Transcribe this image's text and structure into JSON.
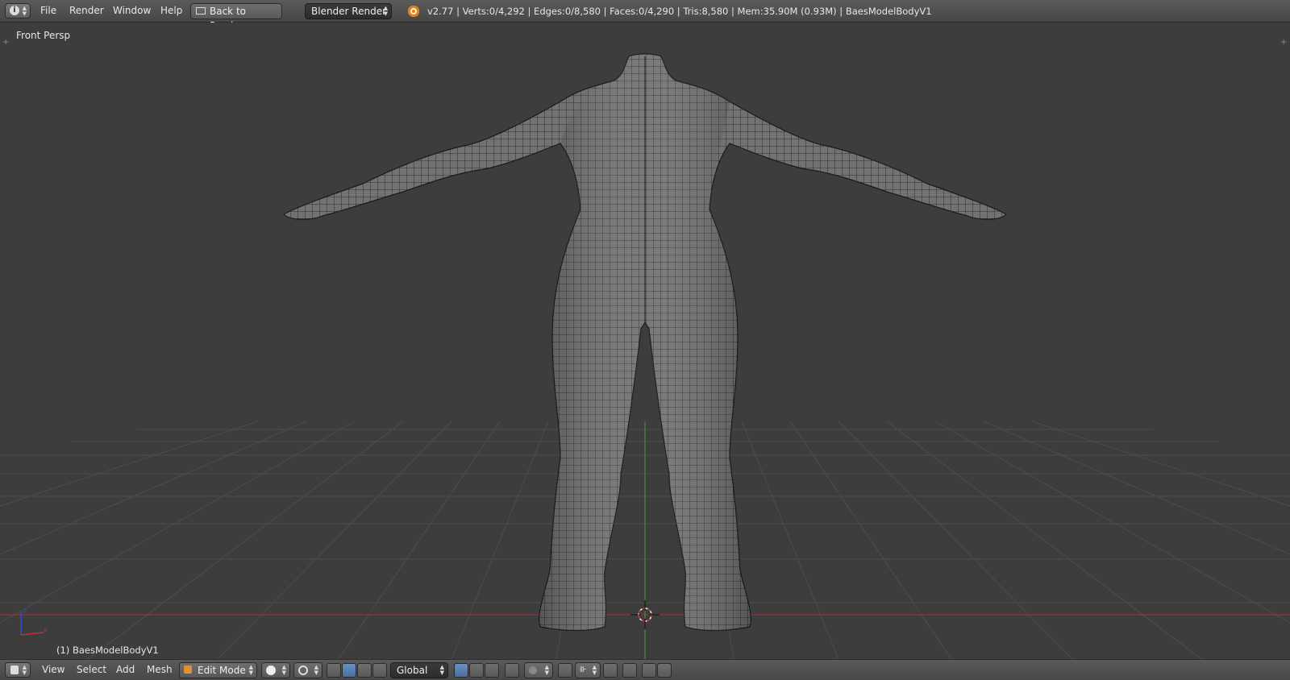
{
  "header": {
    "menus": [
      "File",
      "Render",
      "Window",
      "Help"
    ],
    "back_button": "Back to Previous",
    "render_engine": "Blender Render",
    "stats": "v2.77 | Verts:0/4,292 | Edges:0/8,580 | Faces:0/4,290 | Tris:8,580 | Mem:35.90M (0.93M) | BaesModelBodyV1"
  },
  "viewport": {
    "view_label": "Front Persp",
    "object_label": "(1) BaesModelBodyV1"
  },
  "footer": {
    "menus": [
      "View",
      "Select",
      "Add",
      "Mesh"
    ],
    "mode": "Edit Mode",
    "orientation": "Global"
  },
  "colors": {
    "background": "#3d3d3d",
    "grid": "#4b4b4b",
    "x_axis": "#b0302f",
    "y_axis": "#4c9a3a",
    "mesh_fill": "#6e6e6e",
    "mesh_wire": "#1a1a1a"
  }
}
